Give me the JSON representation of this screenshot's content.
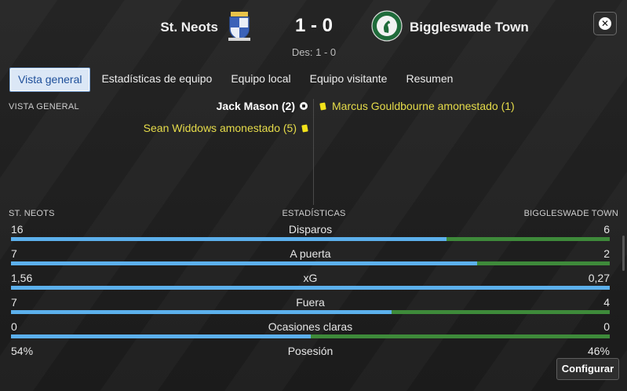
{
  "header": {
    "home_team": "St. Neots",
    "away_team": "Biggleswade Town",
    "score": "1 - 0",
    "halftime": "Des: 1 - 0",
    "close_symbol": "✕"
  },
  "tabs": [
    {
      "label": "Vista general",
      "active": true
    },
    {
      "label": "Estadísticas de equipo",
      "active": false
    },
    {
      "label": "Equipo local",
      "active": false
    },
    {
      "label": "Equipo visitante",
      "active": false
    },
    {
      "label": "Resumen",
      "active": false
    }
  ],
  "overview": {
    "section_label": "VISTA GENERAL",
    "home_events": [
      {
        "text": "Jack Mason (2)",
        "type": "goal"
      },
      {
        "text": "Sean Widdows amonestado (5)",
        "type": "yellow-card"
      }
    ],
    "away_events": [
      {
        "text": "Marcus Gouldbourne amonestado (1)",
        "type": "yellow-card"
      }
    ]
  },
  "stats": {
    "home_label": "ST. NEOTS",
    "title": "ESTADÍSTICAS",
    "away_label": "BIGGLESWADE TOWN",
    "rows": [
      {
        "name": "Disparos",
        "home": "16",
        "away": "6",
        "home_share": 0.727
      },
      {
        "name": "A puerta",
        "home": "7",
        "away": "2",
        "home_share": 0.778
      },
      {
        "name": "xG",
        "home": "1,56",
        "away": "0,27",
        "home_share": 1.0
      },
      {
        "name": "Fuera",
        "home": "7",
        "away": "4",
        "home_share": 0.636
      },
      {
        "name": "Ocasiones claras",
        "home": "0",
        "away": "0",
        "home_share": 0.5
      },
      {
        "name": "Posesión",
        "home": "54%",
        "away": "46%",
        "home_share": 0.54
      }
    ]
  },
  "footer": {
    "configure_label": "Configurar"
  },
  "colors": {
    "home_bar": "#5cb0ec",
    "away_bar": "#3e8a3a",
    "card_yellow": "#f2e21a",
    "active_tab_bg": "#dbe7f6"
  }
}
